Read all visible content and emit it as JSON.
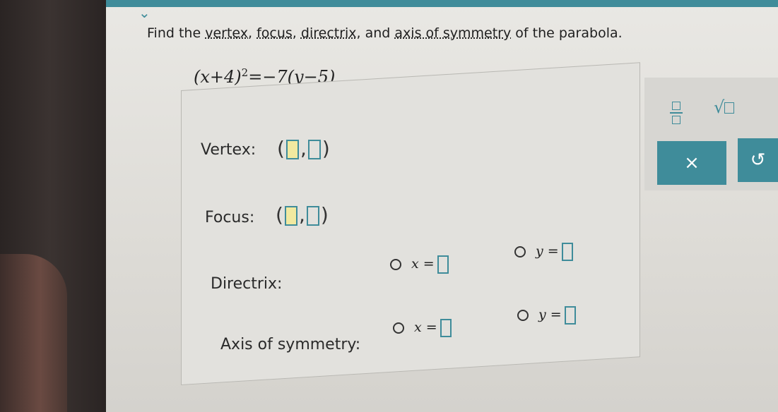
{
  "question": {
    "prefix": "Find the ",
    "vertex_word": "vertex",
    "sep1": ", ",
    "focus_word": "focus",
    "sep2": ", ",
    "directrix_word": "directrix",
    "sep3": ", and ",
    "axis_word": "axis of symmetry",
    "suffix": " of the parabola."
  },
  "equation": {
    "left": "(x+4)",
    "exponent": "2",
    "right": "=−7(y−5)"
  },
  "fields": {
    "vertex_label": "Vertex:",
    "focus_label": "Focus:",
    "directrix_label": "Directrix:",
    "axis_label": "Axis of symmetry:",
    "x_option": "x =",
    "y_option": "y ="
  },
  "toolbar": {
    "fraction_icon": "fraction-icon",
    "sqrt_icon": "square-root-icon",
    "clear_label": "×",
    "undo_label": "↺"
  },
  "colors": {
    "accent": "#3f8c9a",
    "highlight": "#f1e9a0"
  }
}
